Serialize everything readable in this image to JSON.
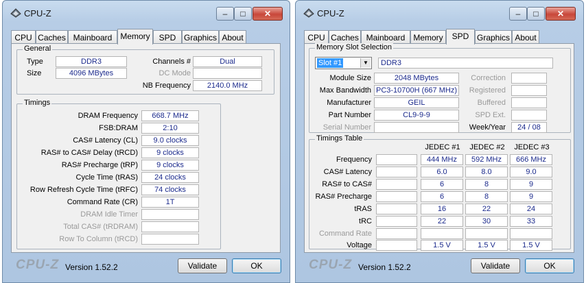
{
  "window_title": "CPU-Z",
  "tabs": [
    "CPU",
    "Caches",
    "Mainboard",
    "Memory",
    "SPD",
    "Graphics",
    "About"
  ],
  "footer": {
    "logo": "CPU-Z",
    "version": "Version 1.52.2",
    "validate": "Validate",
    "ok": "OK"
  },
  "memory": {
    "general": {
      "title": "General",
      "type_label": "Type",
      "type_value": "DDR3",
      "size_label": "Size",
      "size_value": "4096 MBytes",
      "channels_label": "Channels #",
      "channels_value": "Dual",
      "dcmode_label": "DC Mode",
      "dcmode_value": "",
      "nbfreq_label": "NB Frequency",
      "nbfreq_value": "2140.0 MHz"
    },
    "timings": {
      "title": "Timings",
      "rows": [
        {
          "label": "DRAM Frequency",
          "value": "668.7 MHz",
          "enabled": true
        },
        {
          "label": "FSB:DRAM",
          "value": "2:10",
          "enabled": true
        },
        {
          "label": "CAS# Latency (CL)",
          "value": "9.0 clocks",
          "enabled": true
        },
        {
          "label": "RAS# to CAS# Delay (tRCD)",
          "value": "9 clocks",
          "enabled": true
        },
        {
          "label": "RAS# Precharge (tRP)",
          "value": "9 clocks",
          "enabled": true
        },
        {
          "label": "Cycle Time (tRAS)",
          "value": "24 clocks",
          "enabled": true
        },
        {
          "label": "Row Refresh Cycle Time (tRFC)",
          "value": "74 clocks",
          "enabled": true
        },
        {
          "label": "Command Rate (CR)",
          "value": "1T",
          "enabled": true
        },
        {
          "label": "DRAM Idle Timer",
          "value": "",
          "enabled": false
        },
        {
          "label": "Total CAS# (tRDRAM)",
          "value": "",
          "enabled": false
        },
        {
          "label": "Row To Column (tRCD)",
          "value": "",
          "enabled": false
        }
      ]
    }
  },
  "spd": {
    "slot_group_title": "Memory Slot Selection",
    "slot_selected": "Slot #1",
    "slot_type": "DDR3",
    "left_rows": [
      {
        "label": "Module Size",
        "value": "2048 MBytes",
        "enabled": true
      },
      {
        "label": "Max Bandwidth",
        "value": "PC3-10700H (667 MHz)",
        "enabled": true
      },
      {
        "label": "Manufacturer",
        "value": "GEIL",
        "enabled": true
      },
      {
        "label": "Part Number",
        "value": "CL9-9-9",
        "enabled": true
      },
      {
        "label": "Serial Number",
        "value": "",
        "enabled": false
      }
    ],
    "right_rows": [
      {
        "label": "Correction",
        "value": "",
        "enabled": false
      },
      {
        "label": "Registered",
        "value": "",
        "enabled": false
      },
      {
        "label": "Buffered",
        "value": "",
        "enabled": false
      },
      {
        "label": "SPD Ext.",
        "value": "",
        "enabled": false
      },
      {
        "label": "Week/Year",
        "value": "24 / 08",
        "enabled": true
      }
    ],
    "timings_table": {
      "title": "Timings Table",
      "columns": [
        "JEDEC #1",
        "JEDEC #2",
        "JEDEC #3"
      ],
      "rows": [
        {
          "label": "Frequency",
          "values": [
            "444 MHz",
            "592 MHz",
            "666 MHz"
          ],
          "enabled": true
        },
        {
          "label": "CAS# Latency",
          "values": [
            "6.0",
            "8.0",
            "9.0"
          ],
          "enabled": true
        },
        {
          "label": "RAS# to CAS#",
          "values": [
            "6",
            "8",
            "9"
          ],
          "enabled": true
        },
        {
          "label": "RAS# Precharge",
          "values": [
            "6",
            "8",
            "9"
          ],
          "enabled": true
        },
        {
          "label": "tRAS",
          "values": [
            "16",
            "22",
            "24"
          ],
          "enabled": true
        },
        {
          "label": "tRC",
          "values": [
            "22",
            "30",
            "33"
          ],
          "enabled": true
        },
        {
          "label": "Command Rate",
          "values": [
            "",
            "",
            ""
          ],
          "enabled": false
        },
        {
          "label": "Voltage",
          "values": [
            "1.5 V",
            "1.5 V",
            "1.5 V"
          ],
          "enabled": true
        }
      ]
    }
  }
}
